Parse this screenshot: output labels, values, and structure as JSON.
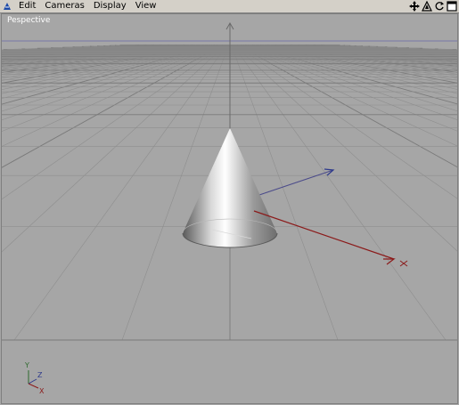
{
  "menu": {
    "items": [
      "Edit",
      "Cameras",
      "Display",
      "View"
    ]
  },
  "toolbar": {
    "icons": [
      "move-icon",
      "rotate-icon",
      "refresh-icon",
      "maximize-icon"
    ]
  },
  "viewport": {
    "label": "Pespective",
    "axes": {
      "y": "Y",
      "z": "Z",
      "x": "X"
    }
  },
  "colors": {
    "background": "#a6a6a6",
    "grid": "#8e8e8e",
    "grid_dark": "#7a7a7a",
    "x_axis": "#8b1a1a",
    "z_axis": "#2e3a8c",
    "y_axis": "#2f6b2f"
  }
}
